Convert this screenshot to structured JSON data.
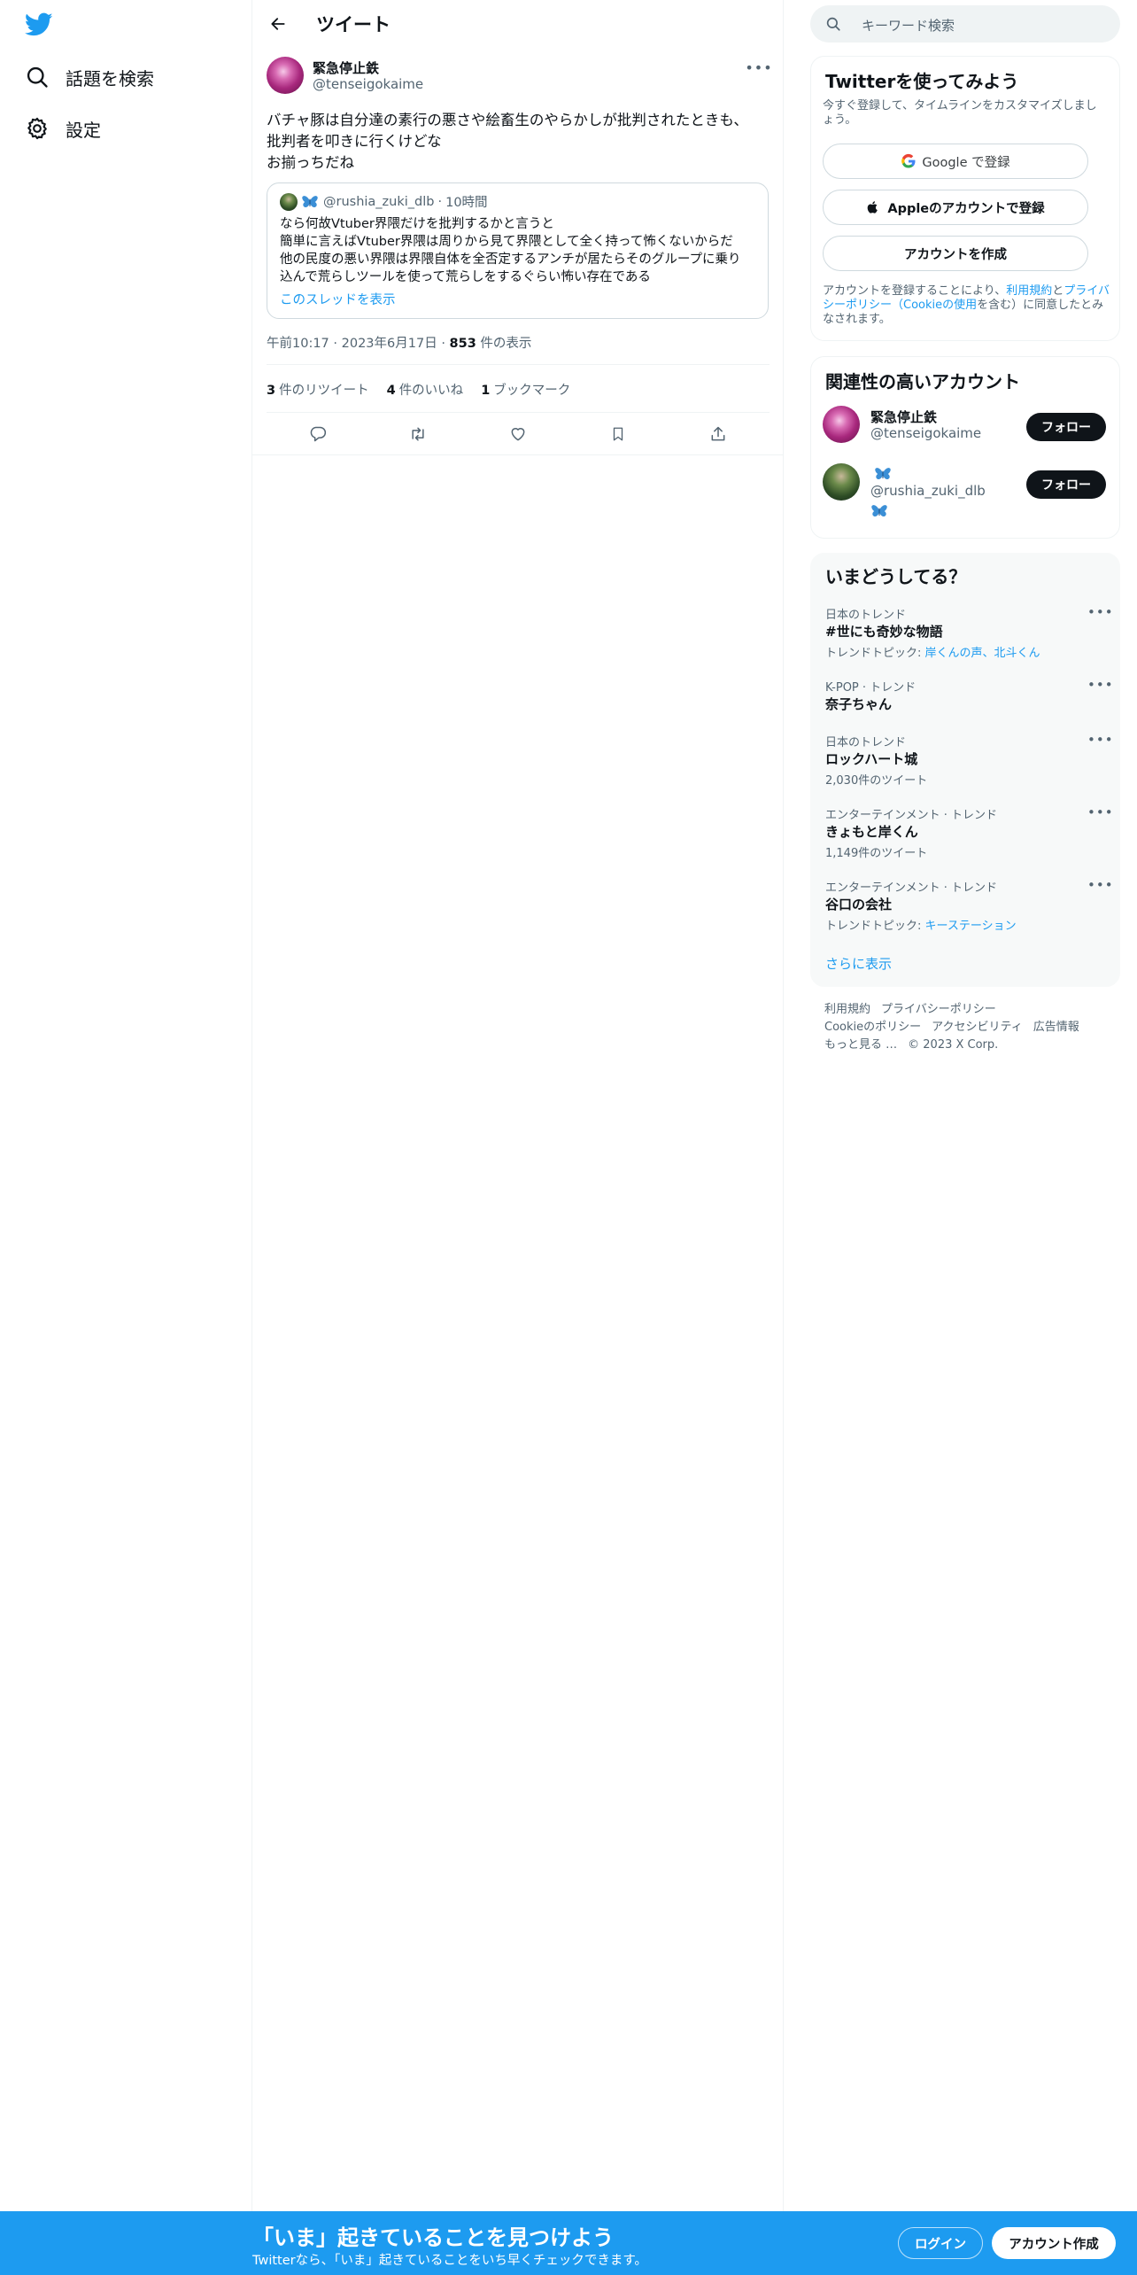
{
  "nav": {
    "logo": "twitter-bird-icon",
    "items": [
      {
        "label": "話題を検索",
        "icon": "search-icon"
      },
      {
        "label": "設定",
        "icon": "gear-icon"
      }
    ]
  },
  "main": {
    "header_title": "ツイート",
    "tweet": {
      "author_name": "緊急停止鉄",
      "author_handle": "@tenseigokaime",
      "text_lines": [
        "バチャ豚は自分達の素行の悪さや絵畜生のやらかしが批判されたときも、",
        "批判者を叩きに行くけどな",
        "お揃っちだね"
      ],
      "quote": {
        "handle": "@rushia_zuki_dlb",
        "separator": "·",
        "time": "10時間",
        "lines": [
          "なら何故Vtuber界隈だけを批判するかと言うと",
          "簡単に言えばVtuber界隈は周りから見て界隈として全く持って怖くないからだ",
          "他の民度の悪い界隈は界隈自体を全否定するアンチが居たらそのグループに乗り",
          "込んで荒らしツールを使って荒らしをするぐらい怖い存在である"
        ],
        "show_thread": "このスレッドを表示"
      },
      "meta": {
        "time": "午前10:17",
        "date": "2023年6月17日",
        "separator": "·",
        "views_count": "853",
        "views_label": "件の表示"
      },
      "stats": {
        "retweets_count": "3",
        "retweets_label": "件のリツイート",
        "likes_count": "4",
        "likes_label": "件のいいね",
        "bookmarks_count": "1",
        "bookmarks_label": "ブックマーク"
      }
    }
  },
  "right": {
    "search_placeholder": "キーワード検索",
    "signup": {
      "title": "Twitterを使ってみよう",
      "desc": "今すぐ登録して、タイムラインをカスタマイズしましょう。",
      "google_label": "Google で登録",
      "apple_label": "Appleのアカウントで登録",
      "create_label": "アカウントを作成",
      "legal_pre": "アカウントを登録することにより、",
      "legal_terms": "利用規約",
      "legal_and": "と",
      "legal_privacy": "プライバシーポリシー（Cookieの使用",
      "legal_post": "を含む）に同意したとみなされます。"
    },
    "related": {
      "title": "関連性の高いアカウント",
      "follow_label": "フォロー",
      "accounts": [
        {
          "name": "緊急停止鉄",
          "handle": "@tenseigokaime"
        },
        {
          "name": "",
          "handle": "@rushia_zuki_dlb"
        }
      ]
    },
    "trends": {
      "title": "いまどうしてる？",
      "items": [
        {
          "context": "日本のトレンド",
          "name": "#世にも奇妙な物語",
          "sub_pre": "トレンドトピック: ",
          "sub_link": "岸くんの声、北斗くん"
        },
        {
          "context": "K-POP · トレンド",
          "name": "奈子ちゃん",
          "sub_pre": "",
          "sub_link": ""
        },
        {
          "context": "日本のトレンド",
          "name": "ロックハート城",
          "sub_pre": "2,030件のツイート",
          "sub_link": ""
        },
        {
          "context": "エンターテインメント · トレンド",
          "name": "きょもと岸くん",
          "sub_pre": "1,149件のツイート",
          "sub_link": ""
        },
        {
          "context": "エンターテインメント · トレンド",
          "name": "谷口の会社",
          "sub_pre": "トレンドトピック: ",
          "sub_link": "キーステーション"
        }
      ],
      "show_more": "さらに表示"
    },
    "footer": {
      "links": [
        "利用規約",
        "プライバシーポリシー",
        "Cookieのポリシー",
        "アクセシビリティ",
        "広告情報",
        "もっと見る …",
        "© 2023 X Corp."
      ]
    }
  },
  "bottom_bar": {
    "title": "「いま」起きていることを見つけよう",
    "subtitle": "Twitterなら、「いま」起きていることをいち早くチェックできます。",
    "login_label": "ログイン",
    "signup_label": "アカウント作成"
  },
  "colors": {
    "brand": "#1d9bf0",
    "text": "#0f1419",
    "secondary": "#536471"
  }
}
